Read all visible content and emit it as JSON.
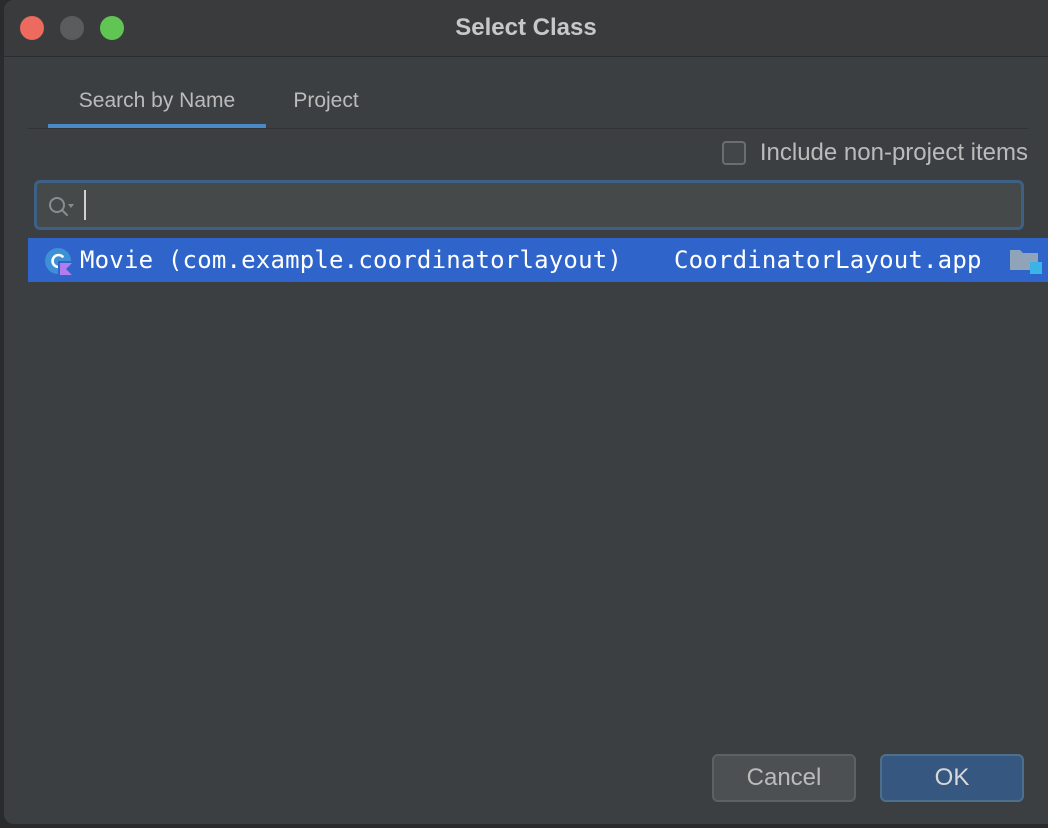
{
  "window": {
    "title": "Select Class"
  },
  "tabs": [
    {
      "label": "Search by Name",
      "active": true
    },
    {
      "label": "Project",
      "active": false
    }
  ],
  "include_non_project": {
    "label": "Include non-project items",
    "checked": false
  },
  "search": {
    "value": "",
    "placeholder": ""
  },
  "results": [
    {
      "icon": "kotlin-class-icon",
      "name": "Movie (com.example.coordinatorlayout)",
      "module": "CoordinatorLayout.app",
      "selected": true
    }
  ],
  "buttons": {
    "cancel_label": "Cancel",
    "ok_label": "OK"
  },
  "colors": {
    "accent": "#4a88c7",
    "selection": "#2f65ca",
    "background": "#3c3f41"
  }
}
